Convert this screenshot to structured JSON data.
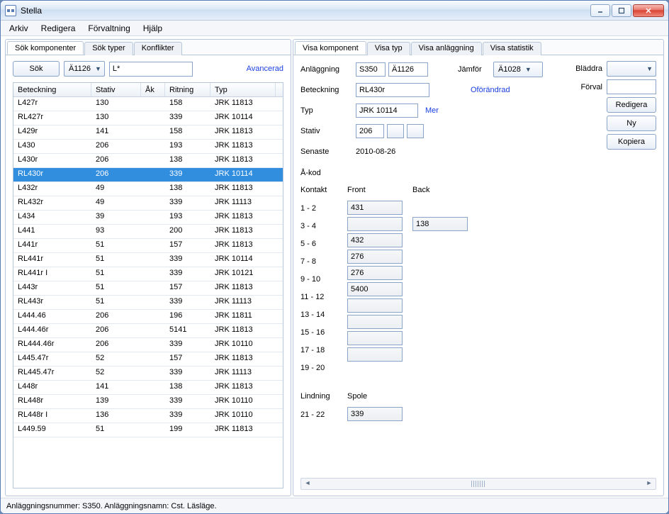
{
  "window": {
    "title": "Stella"
  },
  "menu": {
    "items": [
      "Arkiv",
      "Redigera",
      "Förvaltning",
      "Hjälp"
    ]
  },
  "left": {
    "tabs": [
      "Sök komponenter",
      "Sök typer",
      "Konflikter"
    ],
    "active_tab": 0,
    "search_btn": "Sök",
    "dropdown": "Ä1126",
    "query": "L*",
    "advanced": "Avancerad",
    "columns": [
      "Beteckning",
      "Stativ",
      "Åk",
      "Ritning",
      "Typ"
    ],
    "rows": [
      {
        "bet": "L427r",
        "stav": "130",
        "ak": "",
        "rit": "158",
        "typ": "JRK 11813"
      },
      {
        "bet": "RL427r",
        "stav": "130",
        "ak": "",
        "rit": "339",
        "typ": "JRK 10114"
      },
      {
        "bet": "L429r",
        "stav": "141",
        "ak": "",
        "rit": "158",
        "typ": "JRK 11813"
      },
      {
        "bet": "L430",
        "stav": "206",
        "ak": "",
        "rit": "193",
        "typ": "JRK 11813"
      },
      {
        "bet": "L430r",
        "stav": "206",
        "ak": "",
        "rit": "138",
        "typ": "JRK 11813"
      },
      {
        "bet": "RL430r",
        "stav": "206",
        "ak": "",
        "rit": "339",
        "typ": "JRK 10114",
        "selected": true
      },
      {
        "bet": "L432r",
        "stav": "49",
        "ak": "",
        "rit": "138",
        "typ": "JRK 11813"
      },
      {
        "bet": "RL432r",
        "stav": "49",
        "ak": "",
        "rit": "339",
        "typ": "JRK 11113"
      },
      {
        "bet": "L434",
        "stav": "39",
        "ak": "",
        "rit": "193",
        "typ": "JRK 11813"
      },
      {
        "bet": "L441",
        "stav": "93",
        "ak": "",
        "rit": "200",
        "typ": "JRK 11813"
      },
      {
        "bet": "L441r",
        "stav": "51",
        "ak": "",
        "rit": "157",
        "typ": "JRK 11813"
      },
      {
        "bet": "RL441r",
        "stav": "51",
        "ak": "",
        "rit": "339",
        "typ": "JRK 10114"
      },
      {
        "bet": "RL441r I",
        "stav": "51",
        "ak": "",
        "rit": "339",
        "typ": "JRK 10121"
      },
      {
        "bet": "L443r",
        "stav": "51",
        "ak": "",
        "rit": "157",
        "typ": "JRK 11813"
      },
      {
        "bet": "RL443r",
        "stav": "51",
        "ak": "",
        "rit": "339",
        "typ": "JRK 11113"
      },
      {
        "bet": "L444.46",
        "stav": "206",
        "ak": "",
        "rit": "196",
        "typ": "JRK 11811"
      },
      {
        "bet": "L444.46r",
        "stav": "206",
        "ak": "",
        "rit": "5141",
        "typ": "JRK 11813"
      },
      {
        "bet": "RL444.46r",
        "stav": "206",
        "ak": "",
        "rit": "339",
        "typ": "JRK 10110"
      },
      {
        "bet": "L445.47r",
        "stav": "52",
        "ak": "",
        "rit": "157",
        "typ": "JRK 11813"
      },
      {
        "bet": "RL445.47r",
        "stav": "52",
        "ak": "",
        "rit": "339",
        "typ": "JRK 11113"
      },
      {
        "bet": "L448r",
        "stav": "141",
        "ak": "",
        "rit": "138",
        "typ": "JRK 11813"
      },
      {
        "bet": "RL448r",
        "stav": "139",
        "ak": "",
        "rit": "339",
        "typ": "JRK 10110"
      },
      {
        "bet": "RL448r I",
        "stav": "136",
        "ak": "",
        "rit": "339",
        "typ": "JRK 10110"
      },
      {
        "bet": "L449.59",
        "stav": "51",
        "ak": "",
        "rit": "199",
        "typ": "JRK 11813"
      }
    ]
  },
  "right": {
    "tabs": [
      "Visa komponent",
      "Visa typ",
      "Visa anläggning",
      "Visa statistik"
    ],
    "active_tab": 0,
    "labels": {
      "anlaggning": "Anläggning",
      "beteckning": "Beteckning",
      "typ": "Typ",
      "stativ": "Stativ",
      "senaste": "Senaste",
      "akod": "Å-kod",
      "kontakt": "Kontakt",
      "front": "Front",
      "back": "Back",
      "lindning": "Lindning",
      "spole": "Spole",
      "jamfor": "Jämför",
      "bladdra": "Bläddra",
      "forval": "Förval",
      "oforandrad": "Oförändrad",
      "mer": "Mer"
    },
    "anl_code": "S350",
    "anl_name": "Ä1126",
    "beteckning": "RL430r",
    "typ": "JRK 10114",
    "stativ": "206",
    "senaste": "2010-08-26",
    "jamfor": "Ä1028",
    "buttons": {
      "redigera": "Redigera",
      "ny": "Ny",
      "kopiera": "Kopiera"
    },
    "kontakt_rows": [
      "1 - 2",
      "3 - 4",
      "5 - 6",
      "7 - 8",
      "9 - 10",
      "11 - 12",
      "13 - 14",
      "15 - 16",
      "17 - 18",
      "19 - 20"
    ],
    "kontakt_front": {
      "1 - 2": "431",
      "5 - 6": "432",
      "7 - 8": "276",
      "9 - 10": "276",
      "11 - 12": "5400"
    },
    "kontakt_back": {
      "3 - 4": "138"
    },
    "lindning_rows": [
      "21 - 22"
    ],
    "lindning_vals": {
      "21 - 22": "339"
    }
  },
  "statusbar": "Anläggningsnummer: S350. Anläggningsnamn: Cst. Läsläge."
}
